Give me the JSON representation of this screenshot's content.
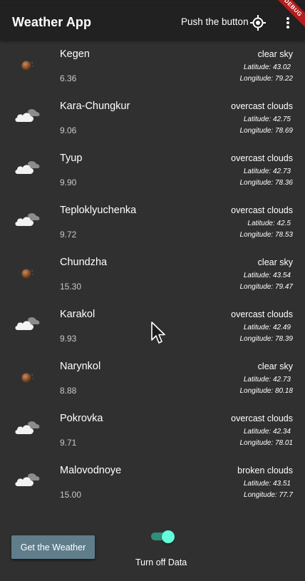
{
  "app": {
    "title": "Weather App",
    "push_label": "Push the button",
    "debug_label": "DEBUG"
  },
  "colors": {
    "background": "#303030",
    "appbar": "#212121",
    "button": "#607d8b",
    "toggle_on": "#64ffda"
  },
  "icons": {
    "clear": "sun-icon",
    "overcast": "cloud-icon",
    "broken": "cloud-icon"
  },
  "cities": [
    {
      "name": "Kegen",
      "temp": "6.36",
      "description": "clear sky",
      "latitude": "Latitude: 43.02",
      "longitude": "Longitude: 79.22",
      "icon": "clear"
    },
    {
      "name": "Kara-Chungkur",
      "temp": "9.06",
      "description": "overcast clouds",
      "latitude": "Latitude: 42.75",
      "longitude": "Longitude: 78.69",
      "icon": "overcast"
    },
    {
      "name": "Tyup",
      "temp": "9.90",
      "description": "overcast clouds",
      "latitude": "Latitude: 42.73",
      "longitude": "Longitude: 78.36",
      "icon": "overcast"
    },
    {
      "name": "Teploklyuchenka",
      "temp": "9.72",
      "description": "overcast clouds",
      "latitude": "Latitude: 42.5",
      "longitude": "Longitude: 78.53",
      "icon": "overcast"
    },
    {
      "name": "Chundzha",
      "temp": "15.30",
      "description": "clear sky",
      "latitude": "Latitude: 43.54",
      "longitude": "Longitude: 79.47",
      "icon": "clear"
    },
    {
      "name": "Karakol",
      "temp": "9.93",
      "description": "overcast clouds",
      "latitude": "Latitude: 42.49",
      "longitude": "Longitude: 78.39",
      "icon": "overcast"
    },
    {
      "name": "Narynkol",
      "temp": "8.88",
      "description": "clear sky",
      "latitude": "Latitude: 42.73",
      "longitude": "Longitude: 80.18",
      "icon": "clear"
    },
    {
      "name": "Pokrovka",
      "temp": "9.71",
      "description": "overcast clouds",
      "latitude": "Latitude: 42.34",
      "longitude": "Longitude: 78.01",
      "icon": "overcast"
    },
    {
      "name": "Malovodnoye",
      "temp": "15.00",
      "description": "broken clouds",
      "latitude": "Latitude: 43.51",
      "longitude": "Longitude: 77.7",
      "icon": "broken"
    }
  ],
  "bottom": {
    "button_label": "Get the Weather",
    "toggle_label": "Turn off Data",
    "toggle_on": true
  }
}
